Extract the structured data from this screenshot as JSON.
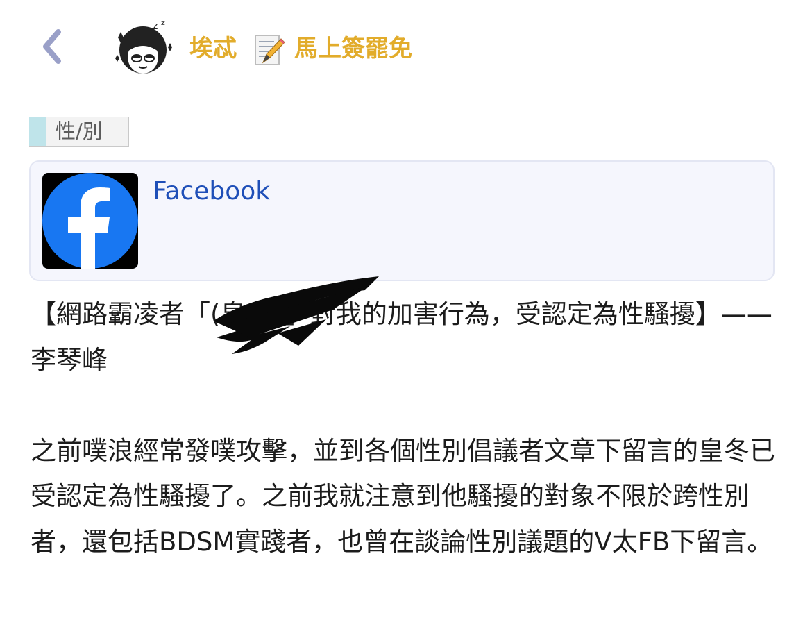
{
  "header": {
    "back_icon": "chevron-left-icon",
    "author_name": "埃忒",
    "memo_icon": "memo-pencil-icon",
    "topic_title": "馬上簽罷免",
    "accent_color": "#e2ac2b"
  },
  "post": {
    "category": "性/別",
    "link_card": {
      "title": "Facebook",
      "icon": "facebook-logo-icon"
    },
    "paragraphs": [
      "【網路霸凌者「(皇冬）」對我的加害行為，受認定為性騷擾】——李琴峰",
      "之前噗浪經常發噗攻擊，並到各個性別倡議者文章下留言的皇冬已受認定為性騷擾了。之前我就注意到他騷擾的對象不限於跨性別者，還包括BDSM實踐者，也曾在談論性別議題的V太FB下留言。"
    ]
  }
}
